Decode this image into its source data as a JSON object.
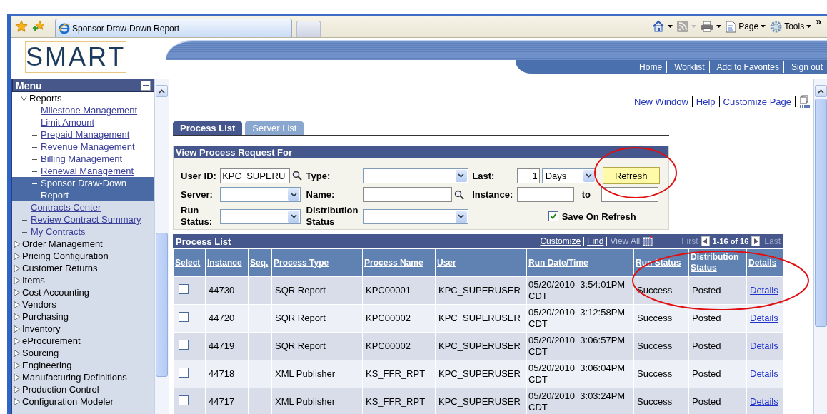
{
  "browser": {
    "tab": {
      "title": "Sponsor Draw-Down Report",
      "selected": true
    },
    "commands": [
      {
        "label": "Page"
      },
      {
        "label": "Tools"
      }
    ],
    "overflow": "»"
  },
  "header": {
    "logo": "SMART",
    "nav_links": [
      "Home",
      "Worklist",
      "Add to Favorites",
      "Sign out"
    ]
  },
  "menu": {
    "title": "Menu",
    "items": [
      {
        "label": "Reports",
        "expanded": true,
        "children": [
          {
            "label": "Milestone Management",
            "selected": false
          },
          {
            "label": "Limit Amount",
            "selected": false
          },
          {
            "label": "Prepaid Management",
            "selected": false
          },
          {
            "label": "Revenue Management",
            "selected": false
          },
          {
            "label": "Billing Management",
            "selected": false
          },
          {
            "label": "Renewal Management",
            "selected": false
          },
          {
            "label": "Sponsor Draw-Down Report",
            "selected": true
          }
        ]
      },
      {
        "label": "Contracts Center"
      },
      {
        "label": "Review Contract Summary"
      },
      {
        "label": "My Contracts"
      }
    ],
    "folders": [
      {
        "label": "Order Management",
        "expanded": false
      },
      {
        "label": "Pricing Configuration",
        "expanded": false
      },
      {
        "label": "Customer Returns",
        "expanded": false
      },
      {
        "label": "Items",
        "expanded": false
      },
      {
        "label": "Cost Accounting",
        "expanded": false
      },
      {
        "label": "Vendors",
        "expanded": false
      },
      {
        "label": "Purchasing",
        "expanded": false
      },
      {
        "label": "Inventory",
        "expanded": false
      },
      {
        "label": "eProcurement",
        "expanded": false
      },
      {
        "label": "Sourcing",
        "expanded": false
      },
      {
        "label": "Engineering",
        "expanded": false
      },
      {
        "label": "Manufacturing Definitions",
        "expanded": false
      },
      {
        "label": "Production Control",
        "expanded": false
      },
      {
        "label": "Configuration Modeler",
        "expanded": false
      }
    ]
  },
  "page_links": [
    "New Window",
    "Help",
    "Customize Page"
  ],
  "tabs": [
    {
      "label": "Process List",
      "selected": true
    },
    {
      "label": "Server List",
      "selected": false
    }
  ],
  "filter": {
    "title": "View Process Request For",
    "user_id": {
      "label": "User ID:",
      "value": "KPC_SUPERU"
    },
    "type": {
      "label": "Type:"
    },
    "last": {
      "label": "Last:",
      "value": "1",
      "unit": "Days"
    },
    "refresh_button": "Refresh",
    "server": {
      "label": "Server:"
    },
    "name": {
      "label": "Name:"
    },
    "instance": {
      "label": "Instance:",
      "to_label": "to"
    },
    "run_status": {
      "label": "Run Status:"
    },
    "distribution_status": {
      "label": "Distribution Status"
    },
    "save_on_refresh": {
      "label": "Save On Refresh",
      "checked": true
    }
  },
  "process_list": {
    "title": "Process List",
    "tools": [
      {
        "label": "Customize",
        "disabled": false
      },
      {
        "label": "Find",
        "disabled": false
      },
      {
        "label": "View All",
        "disabled": true
      }
    ],
    "pager": {
      "first": "First",
      "range": "1-16 of 16",
      "last": "Last"
    },
    "columns": [
      "Select",
      "Instance",
      "Seq.",
      "Process Type",
      "Process Name",
      "User",
      "Run Date/Time",
      "Run Status",
      "Distribution Status",
      "Details"
    ],
    "rows": [
      {
        "selected": false,
        "instance": "44730",
        "process_type": "SQR Report",
        "process_name": "KPC00001",
        "user": "KPC_SUPERUSER",
        "run_datetime": "05/20/2010  3:54:01PM CDT",
        "run_status": "Success",
        "distribution_status": "Posted",
        "details": "Details"
      },
      {
        "selected": false,
        "instance": "44720",
        "process_type": "SQR Report",
        "process_name": "KPC00002",
        "user": "KPC_SUPERUSER",
        "run_datetime": "05/20/2010  3:12:58PM CDT",
        "run_status": "Success",
        "distribution_status": "Posted",
        "details": "Details"
      },
      {
        "selected": false,
        "instance": "44719",
        "process_type": "SQR Report",
        "process_name": "KPC00002",
        "user": "KPC_SUPERUSER",
        "run_datetime": "05/20/2010  3:06:57PM CDT",
        "run_status": "Success",
        "distribution_status": "Posted",
        "details": "Details"
      },
      {
        "selected": false,
        "instance": "44718",
        "process_type": "XML Publisher",
        "process_name": "KS_FFR_RPT",
        "user": "KPC_SUPERUSER",
        "run_datetime": "05/20/2010  3:06:04PM CDT",
        "run_status": "Success",
        "distribution_status": "Posted",
        "details": "Details"
      },
      {
        "selected": false,
        "instance": "44717",
        "process_type": "XML Publisher",
        "process_name": "KS_FFR_RPT",
        "user": "KPC_SUPERUSER",
        "run_datetime": "05/20/2010  3:03:24PM CDT",
        "run_status": "Success",
        "distribution_status": "Posted",
        "details": "Details"
      }
    ]
  }
}
